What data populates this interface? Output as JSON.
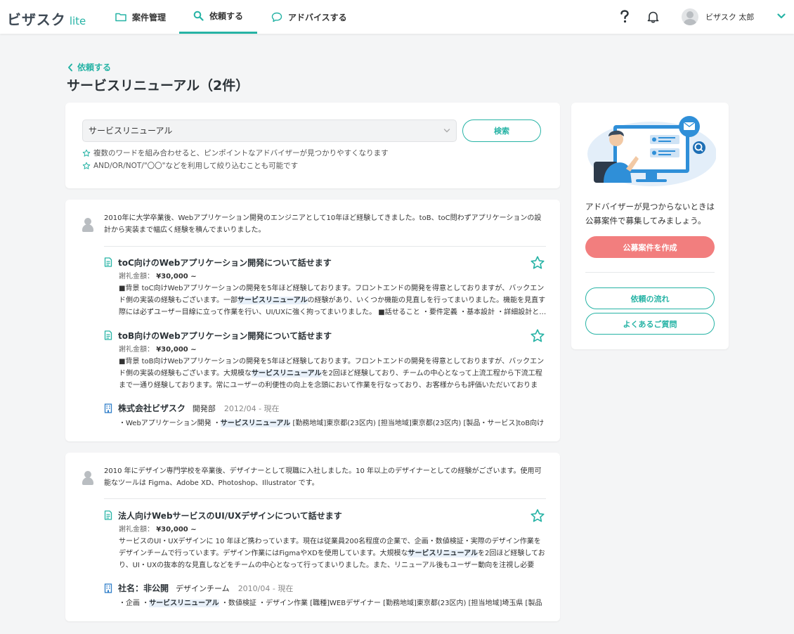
{
  "header": {
    "logo_main": "ビザスク",
    "logo_sub": "lite",
    "nav": [
      {
        "label": "案件管理",
        "icon": "folder-icon"
      },
      {
        "label": "依頼する",
        "icon": "search-icon"
      },
      {
        "label": "アドバイスする",
        "icon": "chat-bubble-icon"
      }
    ],
    "help_icon": "question-icon",
    "bell_icon": "bell-icon",
    "user_name": "ビザスク 太郎"
  },
  "breadcrumb": {
    "back_label": "依頼する"
  },
  "page_title": "サービスリニューアル（2件）",
  "search": {
    "value": "サービスリニューアル",
    "button_label": "検索",
    "tips": [
      "複数のワードを組み合わせると、ピンポイントなアドバイザーが見つかりやすくなります",
      "AND/OR/NOT/\"〇〇\"などを利用して絞り込むことも可能です"
    ]
  },
  "results": [
    {
      "bio": "2010年に大学卒業後、Webアプリケーション開発のエンジニアとして10年ほど経験してきました。toB、toC問わずアプリケーションの設計から実装まで幅広く経験を積んでまいりました。",
      "entries": [
        {
          "title": "toC向けのWebアプリケーション開発について話せます",
          "fee_label": "謝礼金額：",
          "fee": "¥30,000 ~",
          "desc_pre": "■背景 toC向けWebアプリケーションの開発を5年ほど経験しております。フロントエンドの開発を得意としておりますが、バックエンド側の実装の経験もございます。一部",
          "desc_hl": "サービスリニューアル",
          "desc_post": "の経験があり、いくつか機能の見直しを行ってまいりました。機能を見直す際には必ずユーザー目線に立って作業を行い、UI/UXに強く拘ってまいりました。 ■話せること ・要件定義 ・基本設計 ・詳細設計と…"
        },
        {
          "title": "toB向けのWebアプリケーション開発について話せます",
          "fee_label": "謝礼金額：",
          "fee": "¥30,000 ~",
          "desc_pre": "■背景 toB向けWebアプリケーションの開発を5年ほど経験しております。フロントエンドの開発を得意としておりますが、バックエンド側の実装の経験もございます。大規模な",
          "desc_hl": "サービスリニューアル",
          "desc_post": "を2回ほど経験しており、チームの中心となって上流工程から下流工程まで一通り経験しております。常にユーザーの利便性の向上を念頭において作業を行なっており、お客様からも評価いただいております…"
        }
      ],
      "company": {
        "name": "株式会社ビザスク",
        "dept": "開発部",
        "period": "2012/04 - 現在",
        "tags_pre": "・Webアプリケーション開発 ・",
        "tags_hl": "サービスリニューアル",
        "tags_post": " [勤務地域]東京都(23区内) [担当地域]東京都(23区内) [製品・サービス]toB向け…"
      }
    },
    {
      "bio": "2010 年にデザイン専門学校を卒業後、デザイナーとして現職に入社しました。10 年以上のデザイナーとしての経験がございます。使用可能なツールは Figma、Adobe XD、Photoshop、Illustrator です。",
      "entries": [
        {
          "title": "法人向けWebサービスのUI/UXデザインについて話せます",
          "fee_label": "謝礼金額：",
          "fee": "¥30,000 ~",
          "desc_pre": "サービスのUI・UXデザインに 10 年ほど携わっています。現在は従業員200名程度の企業で、企画・数値検証・実際のデザイン作業をデザインチームで行っています。デザイン作業にはFigmaやXDを使用しています。大規模な",
          "desc_hl": "サービスリニューアル",
          "desc_post": "を2回ほど経験しており、UI・UXの抜本的な見直しなどをチームの中心となって行ってまいりました。また、リニューアル後もユーザー動向を注視し必要が…"
        }
      ],
      "company": {
        "name": "社名：非公開",
        "dept": "デザインチーム",
        "period": "2010/04 - 現在",
        "tags_pre": "・企画 ・",
        "tags_hl": "サービスリニューアル",
        "tags_post": " ・数値検証 ・デザイン作業 [職種]WEBデザイナー [勤務地域]東京都(23区内) [担当地域]埼玉県 [製品・…"
      }
    }
  ],
  "sidebar": {
    "text": "アドバイザーが見つからないときは公募案件で募集してみましょう。",
    "primary_button": "公募案件を作成",
    "flow_button": "依頼の流れ",
    "faq_button": "よくあるご質問"
  },
  "colors": {
    "accent": "#26b3a5",
    "primary_button": "#f27e7e",
    "highlight_bg": "#e8f0f9",
    "page_bg": "#f4f5f6"
  }
}
